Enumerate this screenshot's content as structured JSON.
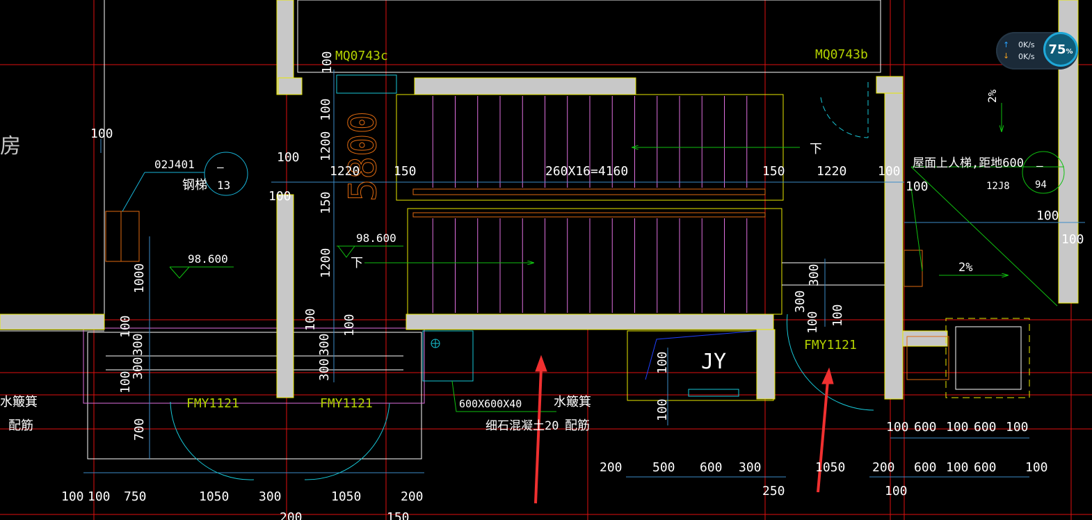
{
  "colors": {
    "background": "#000000",
    "axis_red": "#e01010",
    "wall_fill": "#c8c8c8",
    "wall_outline": "#e8e800",
    "dimension": "#3c8cc8",
    "text_white": "#ffffff",
    "door_label": "#b4d200",
    "stair_lines": "#e070e0",
    "leader_green": "#10c010",
    "cyan": "#18c8d8",
    "orange": "#e06a10",
    "arrow_red": "#f03030"
  },
  "net_widget": {
    "upload": "0K/s",
    "download": "0K/s",
    "percent": "75",
    "percent_sign": "%"
  },
  "labels": {
    "room_fragment": "房",
    "door_mq_left": "MQ0743c",
    "door_mq_right": "MQ0743b",
    "door_fmy_1": "FMY1121",
    "door_fmy_2": "FMY1121",
    "door_fmy_3": "FMY1121",
    "stair_formula": "260X16=4160",
    "big_dim": "5800",
    "down_top": "下",
    "down_left": "下",
    "elev_left": "98.600",
    "elev_mid": "98.600",
    "ref_code": "02J401",
    "ref_name": "钢梯",
    "ref_dash": "–",
    "ref_num": "13",
    "ladder_note": "屋面上人梯,距地600",
    "ladder_code": "12J8",
    "ladder_dash": "–",
    "ladder_num": "94",
    "slope_top": "2%",
    "slope_right": "2%",
    "jy": "JY",
    "pit_size": "600X600X40",
    "pit_concrete": "细石混凝土20",
    "grate_1": "水簸箕",
    "rebar_1": "配筋",
    "grate_2": "水簸箕",
    "rebar_2": "配筋"
  },
  "dimensions": {
    "d_100_a": "100",
    "d_100_b": "100",
    "d_100_c": "100",
    "d_1200_a": "1200",
    "d_150_a": "150",
    "d_1200_b": "1200",
    "d_1220_l": "1220",
    "d_150_l": "150",
    "d_150_r": "150",
    "d_1220_r": "1220",
    "d_100_r": "100",
    "d_100_r2": "100",
    "d_100_far": "100",
    "d_100_far2": "100",
    "d_1000": "1000",
    "d_100_v1": "100",
    "d_300_v1": "300",
    "d_300_v2": "300",
    "d_100_v2": "100",
    "d_700": "700",
    "d_100_v3": "100",
    "d_100_v4": "100",
    "d_300_v3": "300",
    "d_300_v4": "300",
    "d_300_right": "300",
    "d_300_right2": "300",
    "d_100_rv1": "100",
    "d_100_rv2": "100",
    "d_100_jy1": "100",
    "d_100_jy2": "100",
    "b_100_1": "100",
    "b_100_2": "100",
    "b_750": "750",
    "b_1050_1": "1050",
    "b_300": "300",
    "b_1050_2": "1050",
    "b_200": "200",
    "b_200_low": "200",
    "b_150_low": "150",
    "m_200": "200",
    "m_500": "500",
    "m_600": "600",
    "m_300": "300",
    "m_1050": "1050",
    "m_250": "250",
    "r_100_1": "100",
    "r_600_1": "600",
    "r_100_2": "100",
    "r_600_2": "600",
    "r_100_3": "100",
    "r2_200": "200",
    "r2_600_1": "600",
    "r2_100": "100",
    "r2_600_2": "600",
    "r2_100_b": "100",
    "r3_100": "100"
  }
}
